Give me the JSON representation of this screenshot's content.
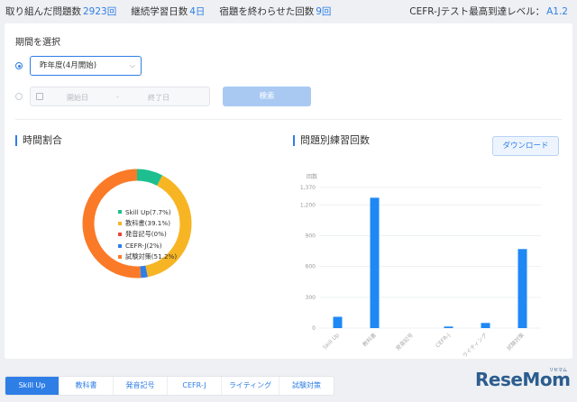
{
  "stats": {
    "problems_label": "取り組んだ問題数",
    "problems_value": "2923回",
    "streak_label": "継続学習日数",
    "streak_value": "4日",
    "homework_label": "宿題を終わらせた回数",
    "homework_value": "9回",
    "level_label": "CEFR-Jテスト最高到達レベル：",
    "level_value": "A1.2"
  },
  "period": {
    "label": "期間を選択",
    "select_value": "昨年度(4月開始)",
    "start_placeholder": "開始日",
    "separator": "-",
    "end_placeholder": "終了日",
    "search_label": "検索"
  },
  "time_panel": {
    "title": "時間割合"
  },
  "count_panel": {
    "title": "問題別練習回数",
    "download_label": "ダウンロード"
  },
  "colors": {
    "accent": "#2f7ee6",
    "skillup": "#1dbf8f",
    "textbook": "#f7b524",
    "phonics": "#e8453c",
    "cefrj": "#2f7ee6",
    "exam": "#fb7a27"
  },
  "chart_data": [
    {
      "type": "pie",
      "variant": "donut",
      "categories": [
        "Skill Up",
        "教科書",
        "発音記号",
        "CEFR-J",
        "試験対策"
      ],
      "values": [
        7.7,
        39.1,
        0,
        2,
        51.2
      ],
      "legend_labels": [
        "Skill Up(7.7%)",
        "教科書(39.1%)",
        "発音記号(0%)",
        "CEFR-J(2%)",
        "試験対策(51.2%)"
      ],
      "colors": [
        "#1dbf8f",
        "#f7b524",
        "#e8453c",
        "#2f7ee6",
        "#fb7a27"
      ]
    },
    {
      "type": "bar",
      "ylabel": "回数",
      "categories": [
        "Skill Up",
        "教科書",
        "発音記号",
        "CEFR-J",
        "ライティング",
        "試験対策"
      ],
      "values": [
        110,
        1270,
        0,
        15,
        50,
        770
      ],
      "ylim": [
        0,
        1370
      ],
      "yticks": [
        0,
        300,
        600,
        900,
        1200,
        1370
      ],
      "ytick_labels": [
        "0",
        "300",
        "600",
        "900",
        "1,200",
        "1,370"
      ],
      "color": "#1e88f5",
      "grid": true
    }
  ],
  "tabs": [
    "Skill Up",
    "教科書",
    "発音記号",
    "CEFR-J",
    "ライティング",
    "試験対策"
  ],
  "logo": {
    "brand": "ReseMom",
    "kana": "リセマム"
  }
}
